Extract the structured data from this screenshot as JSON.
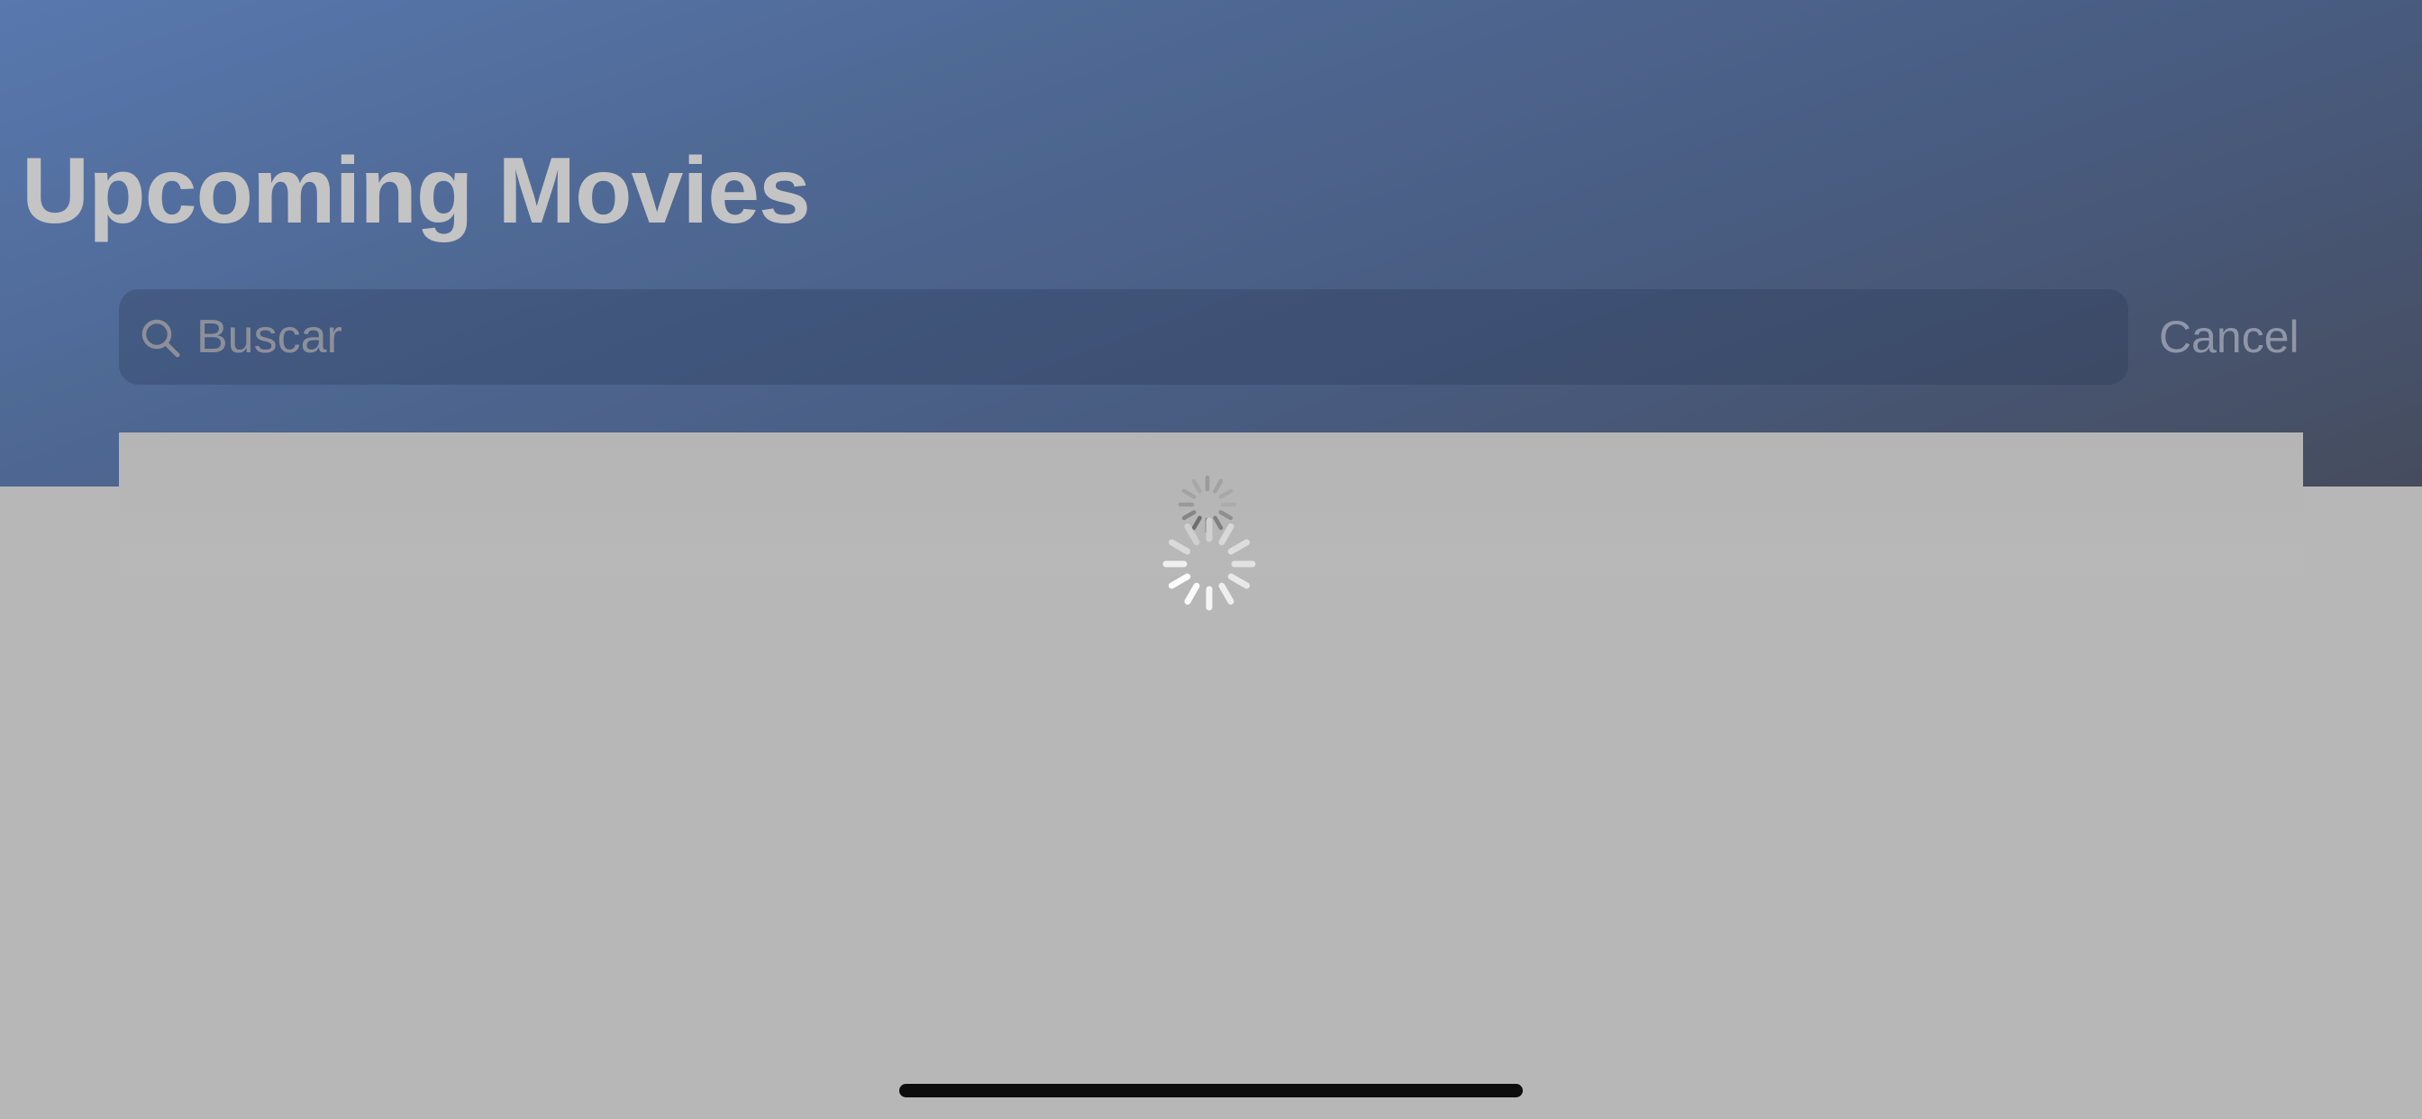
{
  "navigation": {
    "title": "Upcoming Movies"
  },
  "search": {
    "placeholder": "Buscar",
    "value": "",
    "cancel_label": "Cancel"
  },
  "loading": {
    "indicator": "activity-spinner"
  },
  "colors": {
    "header_gradient_start": "#5878ae",
    "header_gradient_end": "#464c5e",
    "content_background": "#b7b7b7",
    "title_text": "#c4c4c4",
    "home_indicator": "#0d0d0d"
  }
}
